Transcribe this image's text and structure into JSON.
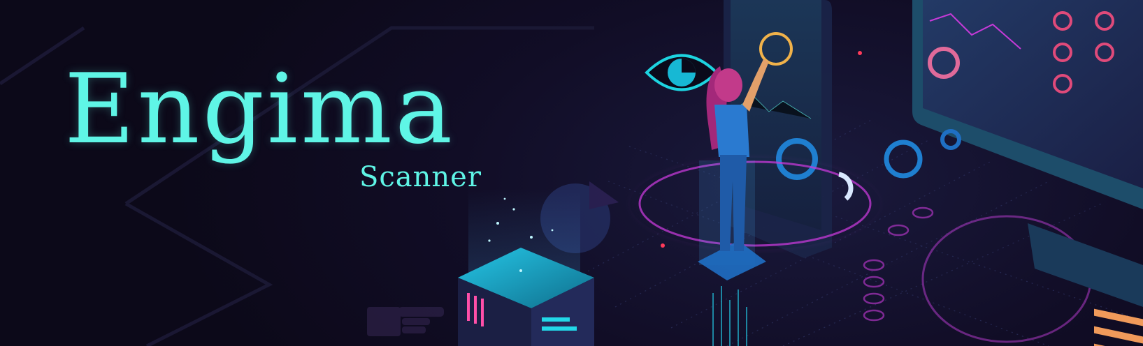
{
  "banner": {
    "title": "Engima",
    "subtitle": "Scanner"
  },
  "colors": {
    "background": "#0d0a1c",
    "accent": "#5ff5e6",
    "magenta": "#c63ad8",
    "blue": "#1e88c8"
  },
  "illustration": {
    "icons": [
      "eye-icon",
      "pie-chart-icon",
      "pointing-hand-icon",
      "analytics-dashboard-icon",
      "data-cube-icon"
    ]
  }
}
